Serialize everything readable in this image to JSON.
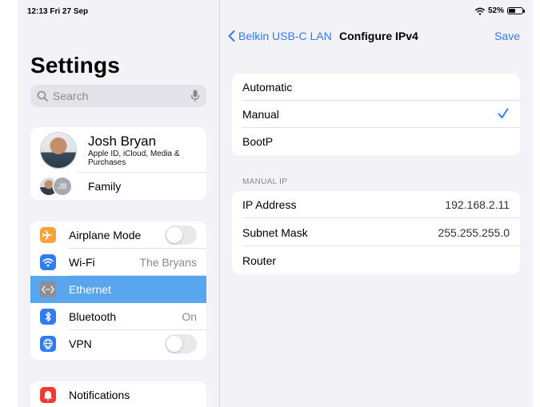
{
  "status_bar": {
    "time": "12:13  Fri 27 Sep",
    "battery": "52%",
    "battery_level": 0.52
  },
  "sidebar": {
    "title": "Settings",
    "search_placeholder": "Search",
    "profile": {
      "name": "Josh Bryan",
      "subtitle": "Apple ID, iCloud, Media & Purchases",
      "family_label": "Family",
      "family_initials": "JB"
    },
    "network_items": [
      {
        "label": "Airplane Mode",
        "icon": "airplane-icon",
        "color": "#f7a23b",
        "value": "",
        "toggle": false
      },
      {
        "label": "Wi-Fi",
        "icon": "wifi-icon",
        "color": "#2f7cf6",
        "value": "The Bryans"
      },
      {
        "label": "Ethernet",
        "icon": "ethernet-icon",
        "color": "#8e8e93",
        "value": "",
        "selected": true
      },
      {
        "label": "Bluetooth",
        "icon": "bluetooth-icon",
        "color": "#2f7cf6",
        "value": "On"
      },
      {
        "label": "VPN",
        "icon": "globe-icon",
        "color": "#2f7cf6",
        "value": "",
        "toggle": false
      }
    ],
    "notifications": {
      "label": "Notifications",
      "icon": "notifications-icon",
      "color": "#ef3b35"
    }
  },
  "detail": {
    "back_label": "Belkin USB-C LAN",
    "title": "Configure IPv4",
    "save_label": "Save",
    "modes": [
      {
        "label": "Automatic",
        "checked": false
      },
      {
        "label": "Manual",
        "checked": true
      },
      {
        "label": "BootP",
        "checked": false
      }
    ],
    "manual_section_label": "MANUAL IP",
    "manual_fields": [
      {
        "label": "IP Address",
        "value": "192.168.2.11"
      },
      {
        "label": "Subnet Mask",
        "value": "255.255.255.0"
      },
      {
        "label": "Router",
        "value": ""
      }
    ]
  },
  "colors": {
    "accent": "#2f7cf6",
    "selected_row": "#5aa6ee"
  }
}
